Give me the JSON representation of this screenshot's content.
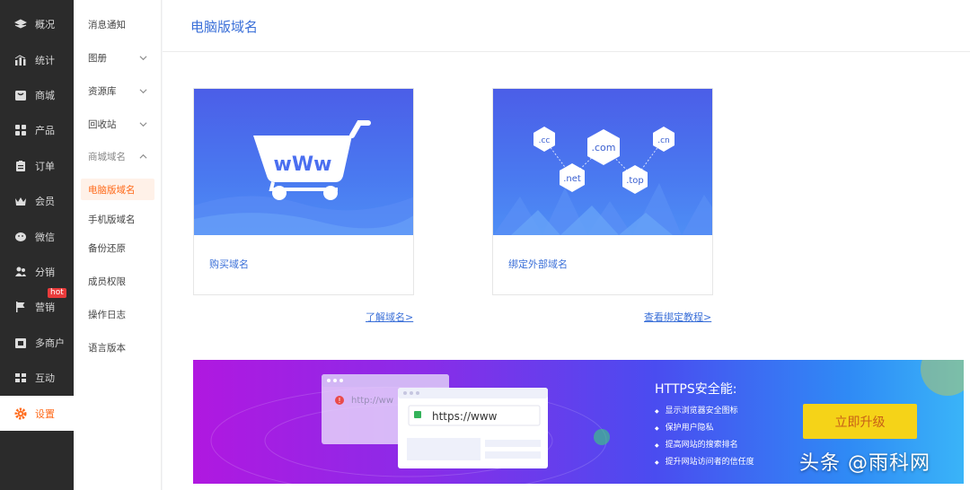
{
  "nav": {
    "items": [
      {
        "label": "概况",
        "icon": "layers-icon"
      },
      {
        "label": "统计",
        "icon": "chart-icon"
      },
      {
        "label": "商城",
        "icon": "store-icon"
      },
      {
        "label": "产品",
        "icon": "grid-icon"
      },
      {
        "label": "订单",
        "icon": "clipboard-icon"
      },
      {
        "label": "会员",
        "icon": "crown-icon"
      },
      {
        "label": "微信",
        "icon": "wechat-icon"
      },
      {
        "label": "分销",
        "icon": "users-icon"
      },
      {
        "label": "营销",
        "icon": "flag-icon"
      },
      {
        "label": "多商户",
        "icon": "merchant-icon"
      },
      {
        "label": "互动",
        "icon": "interact-icon"
      },
      {
        "label": "设置",
        "icon": "gear-icon"
      }
    ],
    "hot_badge": "hot",
    "active_color": "#ff6a1a"
  },
  "submenu": {
    "items": [
      {
        "label": "消息通知"
      },
      {
        "label": "图册"
      },
      {
        "label": "资源库"
      },
      {
        "label": "回收站"
      },
      {
        "label": "商城域名"
      },
      {
        "label": "电脑版域名"
      },
      {
        "label": "手机版域名"
      },
      {
        "label": "备份还原"
      },
      {
        "label": "成员权限"
      },
      {
        "label": "操作日志"
      },
      {
        "label": "语言版本"
      }
    ]
  },
  "page": {
    "title": "电脑版域名",
    "cards": [
      {
        "caption": "购买域名",
        "link": "了解域名>",
        "art_text": "wWw"
      },
      {
        "caption": "绑定外部域名",
        "link": "查看绑定教程>",
        "tlds": [
          ".cc",
          ".com",
          ".cn",
          ".net",
          ".top"
        ]
      }
    ]
  },
  "banner": {
    "title": "HTTPS安全能:",
    "features": [
      "显示浏览器安全图标",
      "保护用户隐私",
      "提高网站的搜索排名",
      "提升网站访问者的信任度"
    ],
    "button": "立即升级",
    "url_back": "http://ww",
    "url_front": "https://www"
  },
  "watermark": "头条 @雨科网"
}
